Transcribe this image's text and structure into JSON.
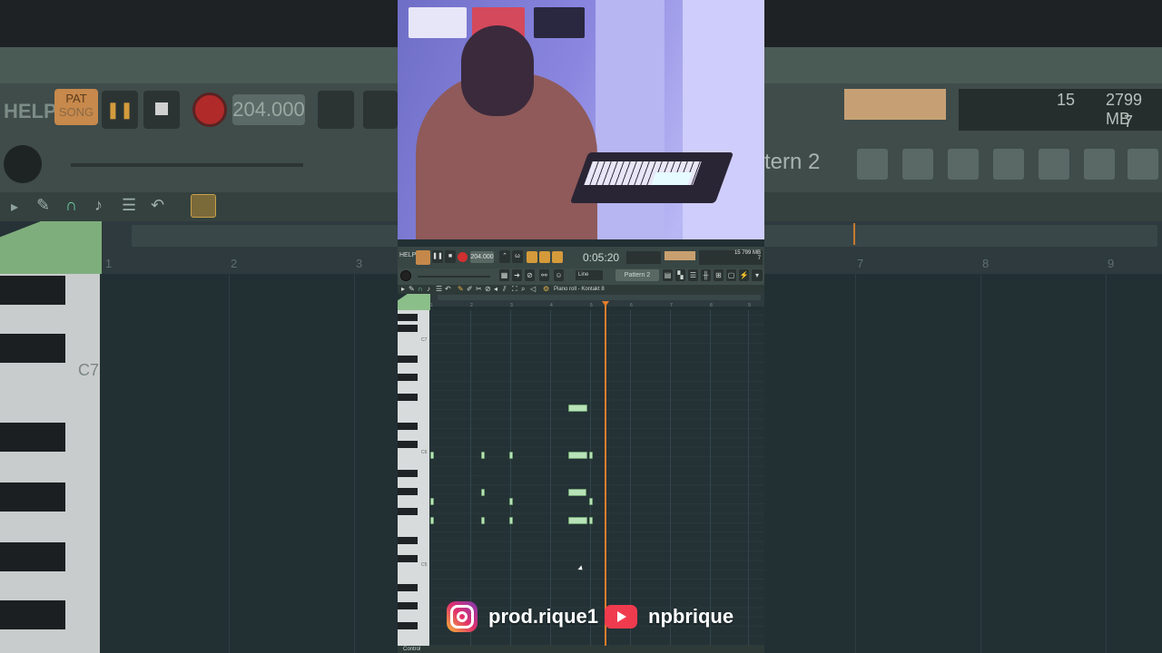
{
  "background": {
    "help_label": "HELP",
    "pat_label": "PAT",
    "song_label": "SONG",
    "tempo": "204.000",
    "octave_label": "C7",
    "bar_numbers": [
      "1",
      "2",
      "3",
      "7",
      "8",
      "9"
    ],
    "pattern_fragment": "tern 2",
    "cpu": "15",
    "memory": "2799 MB",
    "polyphony": "7"
  },
  "daw": {
    "help_label": "HELP",
    "tempo": "204.000",
    "time": "0:05:20",
    "info_cpu": "15",
    "info_mem": "799 MB",
    "info_poly": "7",
    "snap": "Line",
    "pattern": "Pattern 2",
    "window_title": "Piano roll - Kontakt 8",
    "ruler_numbers": [
      "1",
      "2",
      "3",
      "4",
      "5",
      "6",
      "7",
      "8",
      "9"
    ],
    "octave_labels": [
      "C7",
      "C6",
      "C5"
    ],
    "bottom_label": "Control"
  },
  "social": {
    "instagram": "prod.rique1",
    "youtube": "npbrique",
    "instagram_icon": "instagram-icon",
    "youtube_icon": "youtube-icon"
  },
  "colors": {
    "note": "#b8e2b8",
    "playhead": "#e27d2c",
    "record": "#d03030",
    "pat_orange": "#c5884a"
  }
}
